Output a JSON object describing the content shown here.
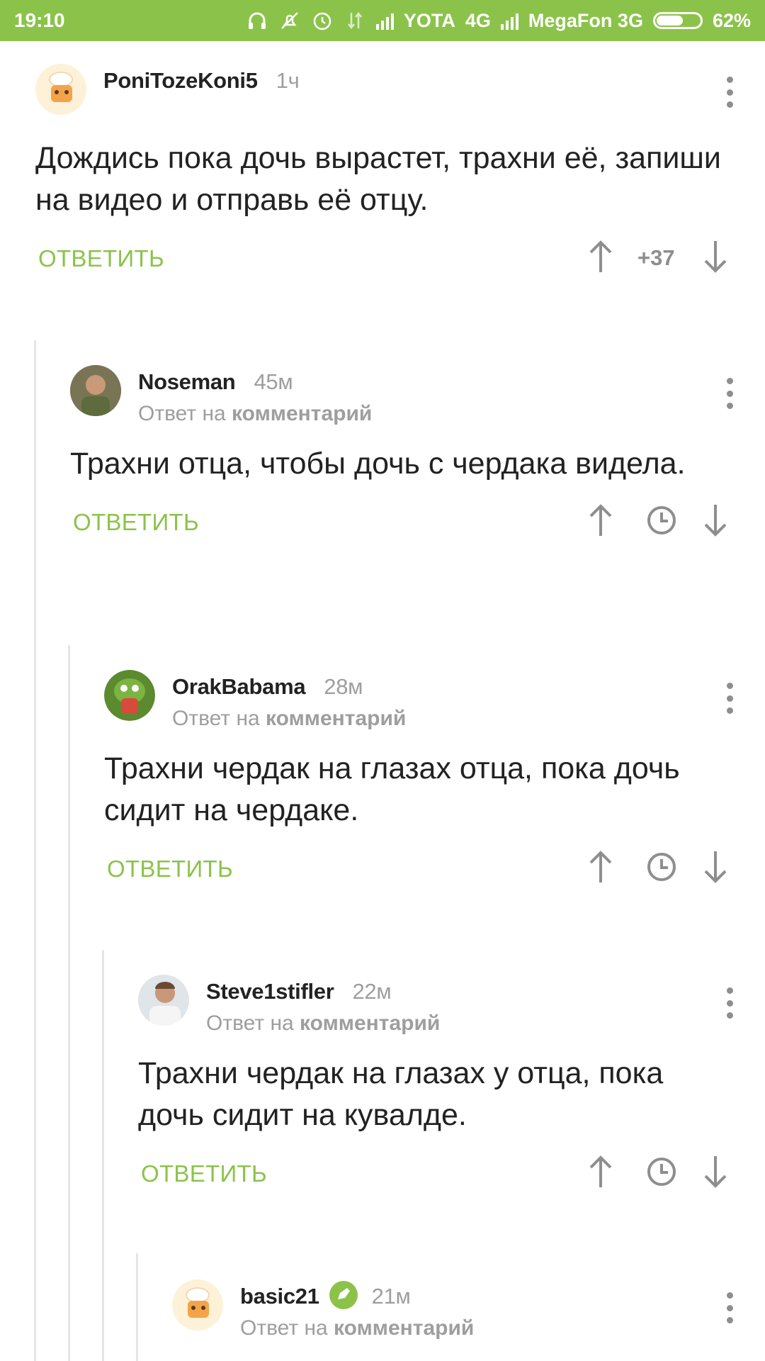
{
  "status_bar": {
    "time": "19:10",
    "carrier1": "YOTA",
    "net1": "4G",
    "carrier2": "MegaFon",
    "net2": "3G",
    "battery": "62%"
  },
  "comments": [
    {
      "username": "PoniTozeKoni5",
      "time": "1ч",
      "text": "Дождись пока дочь вырастет, трахни её, запиши на видео и отправь её отцу.",
      "reply_label": "ОТВЕТИТЬ",
      "score": "+37"
    },
    {
      "username": "Noseman",
      "time": "45м",
      "reply_prefix": "Ответ на",
      "reply_link": "комментарий",
      "text": "Трахни отца, чтобы дочь с чердака видела.",
      "reply_label": "ОТВЕТИТЬ"
    },
    {
      "username": "OrakBabama",
      "time": "28м",
      "reply_prefix": "Ответ на",
      "reply_link": "комментарий",
      "text": "Трахни чердак на глазах отца, пока дочь сидит на чердаке.",
      "reply_label": "ОТВЕТИТЬ"
    },
    {
      "username": "Steve1stifler",
      "time": "22м",
      "reply_prefix": "Ответ на",
      "reply_link": "комментарий",
      "text": "Трахни чердак на глазах у отца, пока дочь сидит на кувалде.",
      "reply_label": "ОТВЕТИТЬ"
    },
    {
      "username": "basic21",
      "time": "21м",
      "reply_prefix": "Ответ на",
      "reply_link": "комментарий"
    }
  ],
  "colors": {
    "accent": "#8bc34a",
    "muted": "#9e9e9e",
    "text": "#222222"
  },
  "icons": [
    "headphones-icon",
    "mute-icon",
    "alarm-icon",
    "data-icon",
    "signal-icon",
    "battery-icon",
    "more-vert-icon",
    "arrow-up-icon",
    "arrow-down-icon",
    "clock-icon",
    "verified-icon"
  ]
}
